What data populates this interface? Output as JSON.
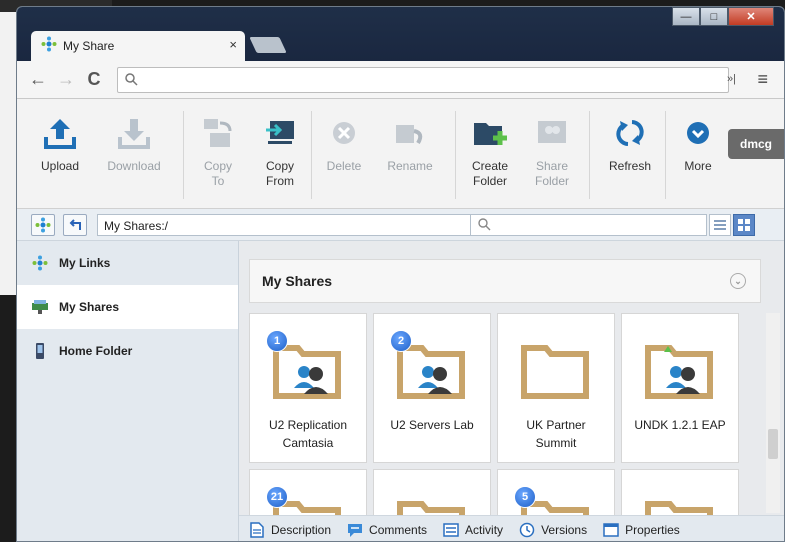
{
  "browser": {
    "tab_title": "My Share",
    "tab_close": "×",
    "controls": {
      "minimize": "—",
      "maximize": "□",
      "close": "✕"
    },
    "nav": {
      "back": "←",
      "forward": "→",
      "reload": "C"
    },
    "address_value": "",
    "ext_overflow": "»|",
    "menu": "≡"
  },
  "toolbar": {
    "upload": "Upload",
    "download": "Download",
    "copy_to_line1": "Copy",
    "copy_to_line2": "To",
    "copy_from_line1": "Copy",
    "copy_from_line2": "From",
    "delete": "Delete",
    "rename": "Rename",
    "create_folder_line1": "Create",
    "create_folder_line2": "Folder",
    "share_folder_line1": "Share",
    "share_folder_line2": "Folder",
    "refresh": "Refresh",
    "more": "More",
    "user": "dmcg"
  },
  "pathbar": {
    "path": "My Shares:/",
    "filter_placeholder": ""
  },
  "sidebar": {
    "items": [
      {
        "label": "My Links"
      },
      {
        "label": "My Shares"
      },
      {
        "label": "Home Folder"
      }
    ]
  },
  "main": {
    "section_title": "My Shares",
    "tiles": [
      {
        "name_line1": "U2 Replication",
        "name_line2": "Camtasia",
        "badge": "1"
      },
      {
        "name_line1": "U2 Servers Lab",
        "name_line2": "",
        "badge": "2"
      },
      {
        "name_line1": "UK Partner",
        "name_line2": "Summit",
        "badge": ""
      },
      {
        "name_line1": "UNDK 1.2.1 EAP",
        "name_line2": "",
        "badge": ""
      },
      {
        "name_line1": "",
        "name_line2": "",
        "badge": "21"
      },
      {
        "name_line1": "",
        "name_line2": "",
        "badge": ""
      },
      {
        "name_line1": "",
        "name_line2": "",
        "badge": "5"
      },
      {
        "name_line1": "",
        "name_line2": "",
        "badge": ""
      }
    ]
  },
  "bottombar": {
    "description": "Description",
    "comments": "Comments",
    "activity": "Activity",
    "versions": "Versions",
    "properties": "Properties"
  },
  "colors": {
    "folder": "#c8a46a",
    "accent_blue": "#1e5fc7",
    "toolbar_icon": "#1f6fb5"
  }
}
